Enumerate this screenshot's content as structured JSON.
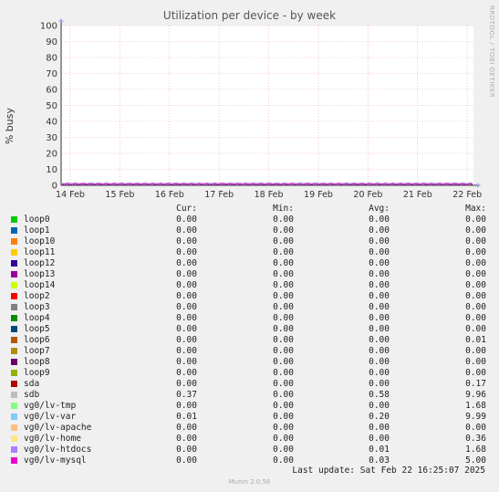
{
  "watermark": "RRDTOOL / TOBI OETIKER",
  "footer": {
    "last_update": "Last update: Sat Feb 22 16:25:07 2025",
    "munin": "Munin 2.0.56"
  },
  "legend_headers": [
    "Cur:",
    "Min:",
    "Avg:",
    "Max:"
  ],
  "chart_data": {
    "type": "line",
    "title": "Utilization per device - by week",
    "ylabel": "% busy",
    "xlabel": "",
    "ylim": [
      0,
      100
    ],
    "yticks": [
      0,
      10,
      20,
      30,
      40,
      50,
      60,
      70,
      80,
      90,
      100
    ],
    "x_ticks": [
      "14 Feb",
      "15 Feb",
      "16 Feb",
      "17 Feb",
      "18 Feb",
      "19 Feb",
      "20 Feb",
      "21 Feb",
      "22 Feb"
    ],
    "grid": true,
    "series": [
      {
        "name": "loop0",
        "color": "#00cc00",
        "cur": "0.00",
        "min": "0.00",
        "avg": "0.00",
        "max": "0.00"
      },
      {
        "name": "loop1",
        "color": "#0066b3",
        "cur": "0.00",
        "min": "0.00",
        "avg": "0.00",
        "max": "0.00"
      },
      {
        "name": "loop10",
        "color": "#ff8000",
        "cur": "0.00",
        "min": "0.00",
        "avg": "0.00",
        "max": "0.00"
      },
      {
        "name": "loop11",
        "color": "#ffcc00",
        "cur": "0.00",
        "min": "0.00",
        "avg": "0.00",
        "max": "0.00"
      },
      {
        "name": "loop12",
        "color": "#330099",
        "cur": "0.00",
        "min": "0.00",
        "avg": "0.00",
        "max": "0.00"
      },
      {
        "name": "loop13",
        "color": "#990099",
        "cur": "0.00",
        "min": "0.00",
        "avg": "0.00",
        "max": "0.00"
      },
      {
        "name": "loop14",
        "color": "#ccff00",
        "cur": "0.00",
        "min": "0.00",
        "avg": "0.00",
        "max": "0.00"
      },
      {
        "name": "loop2",
        "color": "#ff0000",
        "cur": "0.00",
        "min": "0.00",
        "avg": "0.00",
        "max": "0.00"
      },
      {
        "name": "loop3",
        "color": "#808080",
        "cur": "0.00",
        "min": "0.00",
        "avg": "0.00",
        "max": "0.00"
      },
      {
        "name": "loop4",
        "color": "#008f00",
        "cur": "0.00",
        "min": "0.00",
        "avg": "0.00",
        "max": "0.00"
      },
      {
        "name": "loop5",
        "color": "#00487d",
        "cur": "0.00",
        "min": "0.00",
        "avg": "0.00",
        "max": "0.00"
      },
      {
        "name": "loop6",
        "color": "#b35a00",
        "cur": "0.00",
        "min": "0.00",
        "avg": "0.00",
        "max": "0.01"
      },
      {
        "name": "loop7",
        "color": "#b38f00",
        "cur": "0.00",
        "min": "0.00",
        "avg": "0.00",
        "max": "0.00"
      },
      {
        "name": "loop8",
        "color": "#6b006b",
        "cur": "0.00",
        "min": "0.00",
        "avg": "0.00",
        "max": "0.00"
      },
      {
        "name": "loop9",
        "color": "#8fb300",
        "cur": "0.00",
        "min": "0.00",
        "avg": "0.00",
        "max": "0.00"
      },
      {
        "name": "sda",
        "color": "#b30000",
        "cur": "0.00",
        "min": "0.00",
        "avg": "0.00",
        "max": "0.17"
      },
      {
        "name": "sdb",
        "color": "#bebebe",
        "cur": "0.37",
        "min": "0.00",
        "avg": "0.58",
        "max": "9.96"
      },
      {
        "name": "vg0/lv-tmp",
        "color": "#80ff80",
        "cur": "0.00",
        "min": "0.00",
        "avg": "0.00",
        "max": "1.68"
      },
      {
        "name": "vg0/lv-var",
        "color": "#80c9ff",
        "cur": "0.01",
        "min": "0.00",
        "avg": "0.20",
        "max": "9.99"
      },
      {
        "name": "vg0/lv-apache",
        "color": "#ffc080",
        "cur": "0.00",
        "min": "0.00",
        "avg": "0.00",
        "max": "0.00"
      },
      {
        "name": "vg0/lv-home",
        "color": "#ffe680",
        "cur": "0.00",
        "min": "0.00",
        "avg": "0.00",
        "max": "0.36"
      },
      {
        "name": "vg0/lv-htdocs",
        "color": "#aa80ff",
        "cur": "0.00",
        "min": "0.00",
        "avg": "0.01",
        "max": "1.68"
      },
      {
        "name": "vg0/lv-mysql",
        "color": "#ee00cc",
        "cur": "0.00",
        "min": "0.00",
        "avg": "0.03",
        "max": "5.00"
      }
    ]
  }
}
